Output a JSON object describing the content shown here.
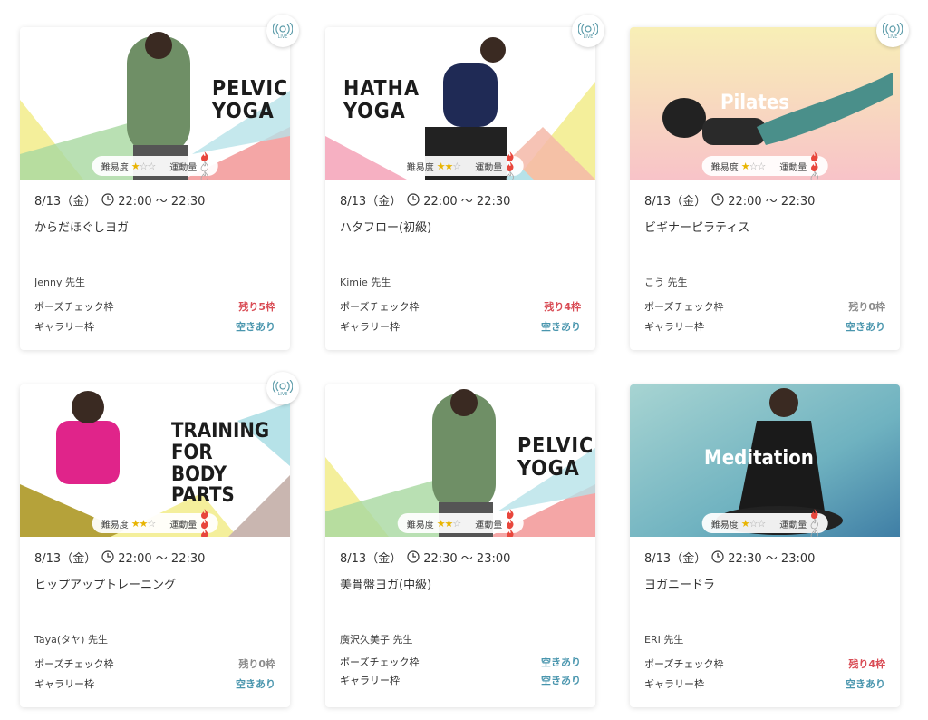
{
  "labels": {
    "difficulty": "難易度",
    "intensity": "運動量",
    "pose_check": "ポーズチェック枠",
    "gallery": "ギャラリー枠",
    "live": "LIVE"
  },
  "colors": {
    "status_red": "#d94c55",
    "status_gray": "#8c8c8c",
    "status_teal": "#4a96ae",
    "star": "#e8b400",
    "flame": "#e8463c"
  },
  "cards": [
    {
      "thumb_title": "PELVIC\nYOGA",
      "live": true,
      "difficulty_stars": 1,
      "intensity_flames": 1,
      "date": "8/13（金）",
      "time": "22:00 〜 22:30",
      "title": "からだほぐしヨガ",
      "teacher": "Jenny 先生",
      "pose_status": "残り5枠",
      "pose_status_type": "red",
      "gallery_status": "空きあり",
      "gallery_status_type": "teal"
    },
    {
      "thumb_title": "HATHA\nYOGA",
      "live": true,
      "difficulty_stars": 2,
      "intensity_flames": 2,
      "date": "8/13（金）",
      "time": "22:00 〜 22:30",
      "title": "ハタフロー(初級)",
      "teacher": "Kimie 先生",
      "pose_status": "残り4枠",
      "pose_status_type": "red",
      "gallery_status": "空きあり",
      "gallery_status_type": "teal"
    },
    {
      "thumb_title": "Pilates",
      "live": true,
      "difficulty_stars": 1,
      "intensity_flames": 2,
      "date": "8/13（金）",
      "time": "22:00 〜 22:30",
      "title": "ビギナーピラティス",
      "teacher": "こう 先生",
      "pose_status": "残り0枠",
      "pose_status_type": "gray",
      "gallery_status": "空きあり",
      "gallery_status_type": "teal"
    },
    {
      "thumb_title": "TRAINING\nFOR\nBODY PARTS",
      "live": true,
      "difficulty_stars": 2,
      "intensity_flames": 3,
      "date": "8/13（金）",
      "time": "22:00 〜 22:30",
      "title": "ヒップアップトレーニング",
      "teacher": "Taya(タヤ) 先生",
      "pose_status": "残り0枠",
      "pose_status_type": "gray",
      "gallery_status": "空きあり",
      "gallery_status_type": "teal"
    },
    {
      "thumb_title": "PELVIC\nYOGA",
      "live": false,
      "difficulty_stars": 2,
      "intensity_flames": 3,
      "date": "8/13（金）",
      "time": "22:30 〜 23:00",
      "title": "美骨盤ヨガ(中級)",
      "teacher": "廣沢久美子 先生",
      "pose_status": "空きあり",
      "pose_status_type": "teal",
      "gallery_status": "空きあり",
      "gallery_status_type": "teal"
    },
    {
      "thumb_title": "Meditation",
      "live": false,
      "difficulty_stars": 1,
      "intensity_flames": 1,
      "date": "8/13（金）",
      "time": "22:30 〜 23:00",
      "title": "ヨガニードラ",
      "teacher": "ERI 先生",
      "pose_status": "残り4枠",
      "pose_status_type": "red",
      "gallery_status": "空きあり",
      "gallery_status_type": "teal"
    }
  ]
}
